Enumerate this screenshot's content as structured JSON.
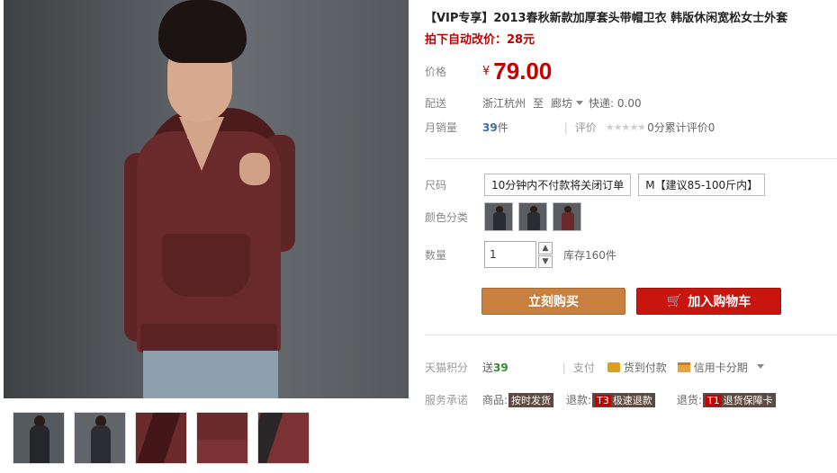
{
  "product": {
    "title": "【VIP专享】2013春秋新款加厚套头带帽卫衣 韩版休闲宽松女士外套",
    "promo": "拍下自动改价：28元"
  },
  "price": {
    "label": "价格",
    "symbol": "¥",
    "value": "79.00"
  },
  "shipping": {
    "label": "配送",
    "from": "浙江杭州",
    "to_word": "至",
    "to": "廊坊",
    "fee": "快递: 0.00"
  },
  "sales": {
    "label": "月销量",
    "count": "39",
    "unit": "件",
    "review_label": "评价",
    "stars": "★★★★★",
    "score": "0分",
    "review_text": "累计评价",
    "review_count": "0"
  },
  "size": {
    "label": "尺码",
    "options": [
      "10分钟内不付款将关闭订单",
      "M【建议85-100斤内】"
    ]
  },
  "color": {
    "label": "颜色分类",
    "swatch_colors": [
      "#2b2c30",
      "#2b2c30",
      "#6a2a2b"
    ]
  },
  "quantity": {
    "label": "数量",
    "value": "1",
    "stock": "库存160件"
  },
  "buttons": {
    "buy": "立刻购买",
    "cart": "加入购物车"
  },
  "points": {
    "label": "天猫积分",
    "prefix": "送",
    "value": "39",
    "pay_label": "支付",
    "cod": "货到付款",
    "credit": "信用卡分期"
  },
  "service": {
    "label": "服务承诺",
    "items": [
      {
        "prefix": "商品:",
        "tag": "按时发货",
        "tag_code": ""
      },
      {
        "prefix": "退款:",
        "tag": "极速退款",
        "tag_code": "T3"
      },
      {
        "prefix": "退货:",
        "tag": "退货保障卡",
        "tag_code": "T1"
      }
    ]
  },
  "colors": {
    "accent_red": "#c40000",
    "buy_button": "#c9803f",
    "cart_button": "#c8160f",
    "hoodie": "#6a2a2b"
  }
}
